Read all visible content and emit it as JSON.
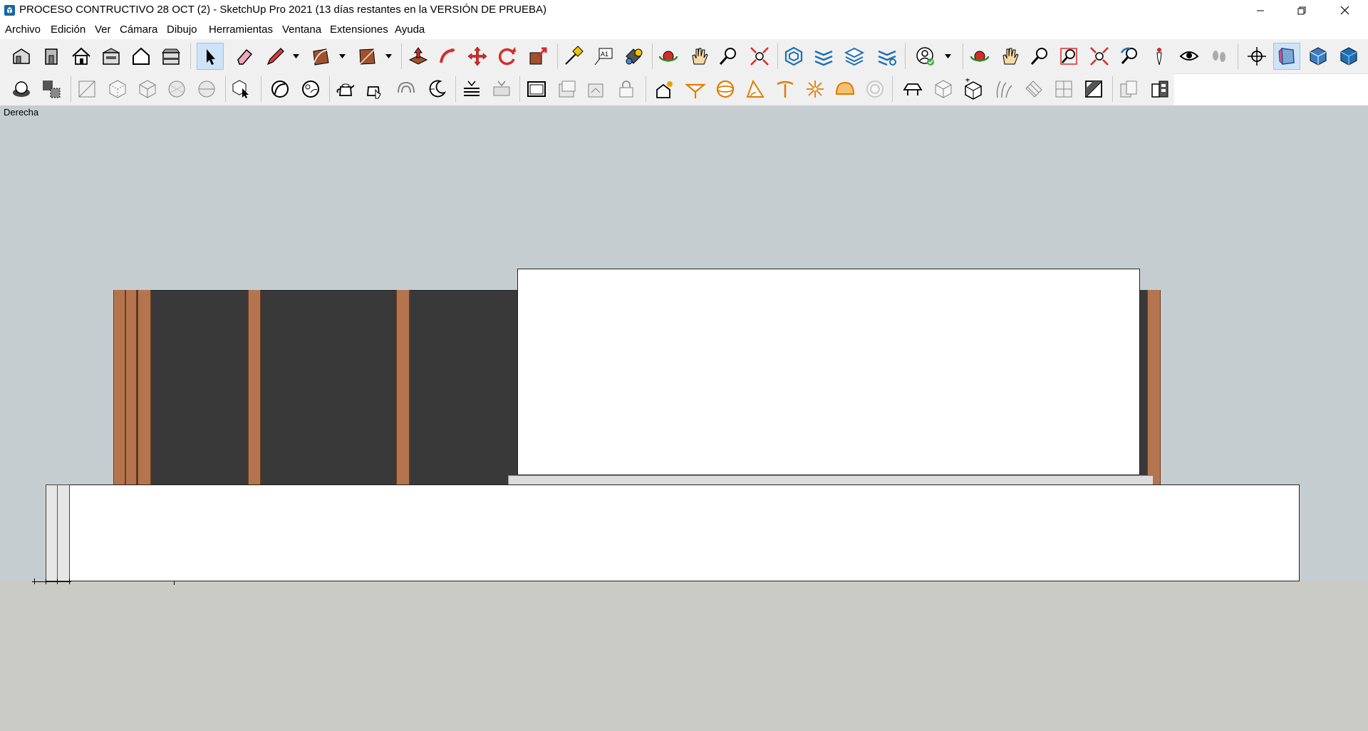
{
  "window": {
    "title": "PROCESO CONTRUCTIVO 28 OCT (2) - SketchUp Pro 2021 (13 días restantes en la VERSIÓN DE PRUEBA)",
    "minimize_icon": "minimize-icon",
    "restore_icon": "restore-icon",
    "close_icon": "close-icon"
  },
  "menu": {
    "items": [
      "Archivo",
      "Edición",
      "Ver",
      "Cámara",
      "Dibujo",
      "Herramientas",
      "Ventana",
      "Extensiones",
      "Ayuda"
    ]
  },
  "toolbar_primary": {
    "icons": [
      "iso-view",
      "front-view-house",
      "top-view-home",
      "back-view",
      "right-view",
      "left-view",
      "select-arrow",
      "eraser",
      "pencil-line",
      "arc",
      "rectangle",
      "push-pull",
      "follow-me",
      "move",
      "rotate",
      "scale",
      "tape-measure",
      "text",
      "paint-bucket",
      "orbit",
      "pan",
      "zoom",
      "zoom-extents",
      "component",
      "section-plane",
      "layers",
      "outliner",
      "account",
      "orbit-2",
      "pan-2",
      "zoom-2",
      "zoom-window",
      "zoom-extents-2",
      "previous-view",
      "position-camera",
      "look-around",
      "walk",
      "crosshair",
      "3d-box-active",
      "3d-box-2",
      "3d-box-3"
    ],
    "active": [
      "select-arrow",
      "3d-box-active"
    ]
  },
  "toolbar_secondary": {
    "icons": [
      "shadow",
      "guide",
      "xray",
      "back-edges",
      "wireframe",
      "hidden-line",
      "shaded",
      "shaded-textures",
      "monochrome",
      "component-select",
      "sandbox-1",
      "sandbox-2",
      "teapot",
      "teapot-click",
      "soften",
      "moon",
      "hatch-1",
      "hatch-2",
      "window-1",
      "window-2",
      "window-3",
      "lock",
      "sun-house",
      "umbrella",
      "sphere",
      "protractor",
      "stamp",
      "burst",
      "dome",
      "disc",
      "camera-plane",
      "cube-1",
      "cube-2",
      "grass",
      "slash-box",
      "grid-box",
      "cut-box",
      "duplicate",
      "building"
    ]
  },
  "viewport": {
    "view_label": "Derecha",
    "sky_color": "#c5cdd0",
    "ground_color": "#cbcbc6",
    "wall_color": "#3a3939",
    "post_color": "#b4744d"
  }
}
